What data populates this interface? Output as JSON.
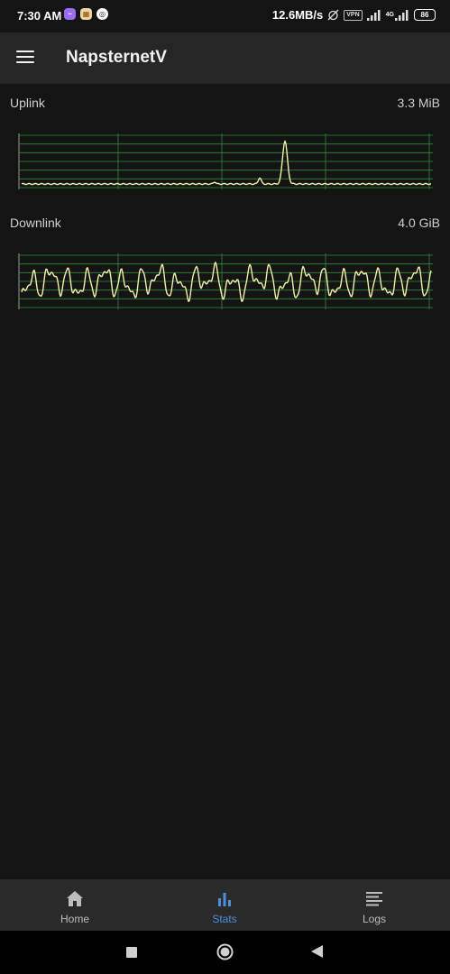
{
  "status_bar": {
    "time": "7:30 AM",
    "speed": "12.6MB/s",
    "vpn": "VPN",
    "network": "4G",
    "battery": "86"
  },
  "app_bar": {
    "title": "NapsternetV"
  },
  "stats": {
    "uplink": {
      "label": "Uplink",
      "value": "3.3 MiB"
    },
    "downlink": {
      "label": "Downlink",
      "value": "4.0 GiB"
    }
  },
  "bottom_nav": {
    "items": [
      {
        "label": "Home",
        "icon": "home-icon",
        "active": false
      },
      {
        "label": "Stats",
        "icon": "bar-chart-icon",
        "active": true
      },
      {
        "label": "Logs",
        "icon": "logs-icon",
        "active": false
      }
    ]
  },
  "colors": {
    "graph_line": "#f2f0a6",
    "graph_grid": "#2f8a3a",
    "active_tab": "#4f8fd8",
    "app_bar": "#262626",
    "background": "#141414"
  }
}
